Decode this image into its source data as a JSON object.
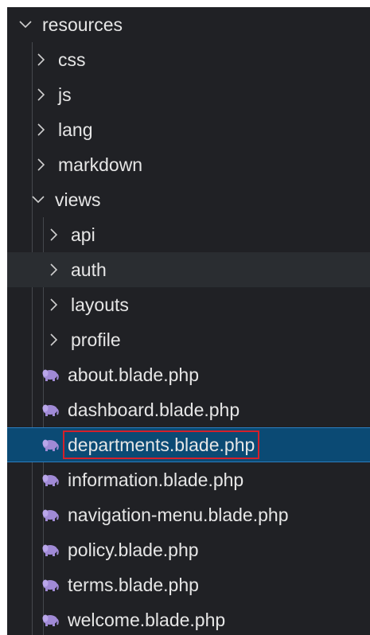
{
  "explorer": {
    "root": {
      "label": "resources",
      "expanded": true
    },
    "folders": [
      {
        "label": "css",
        "expanded": false
      },
      {
        "label": "js",
        "expanded": false
      },
      {
        "label": "lang",
        "expanded": false
      },
      {
        "label": "markdown",
        "expanded": false
      }
    ],
    "views": {
      "label": "views",
      "expanded": true,
      "subfolders": [
        {
          "label": "api",
          "expanded": false
        },
        {
          "label": "auth",
          "expanded": false
        },
        {
          "label": "layouts",
          "expanded": false
        },
        {
          "label": "profile",
          "expanded": false
        }
      ],
      "files": [
        {
          "label": "about.blade.php",
          "icon": "php-elephant-icon"
        },
        {
          "label": "dashboard.blade.php",
          "icon": "php-elephant-icon"
        },
        {
          "label": "departments.blade.php",
          "icon": "php-elephant-icon",
          "selected": true,
          "highlighted": true
        },
        {
          "label": "information.blade.php",
          "icon": "php-elephant-icon"
        },
        {
          "label": "navigation-menu.blade.php",
          "icon": "php-elephant-icon"
        },
        {
          "label": "policy.blade.php",
          "icon": "php-elephant-icon"
        },
        {
          "label": "terms.blade.php",
          "icon": "php-elephant-icon"
        },
        {
          "label": "welcome.blade.php",
          "icon": "php-elephant-icon"
        }
      ]
    },
    "colors": {
      "background": "#202125",
      "selection": "#0b4a74",
      "selection_border": "#2b7ec0",
      "highlight_box": "#d4202a",
      "php_icon": "#a08ad6"
    }
  }
}
